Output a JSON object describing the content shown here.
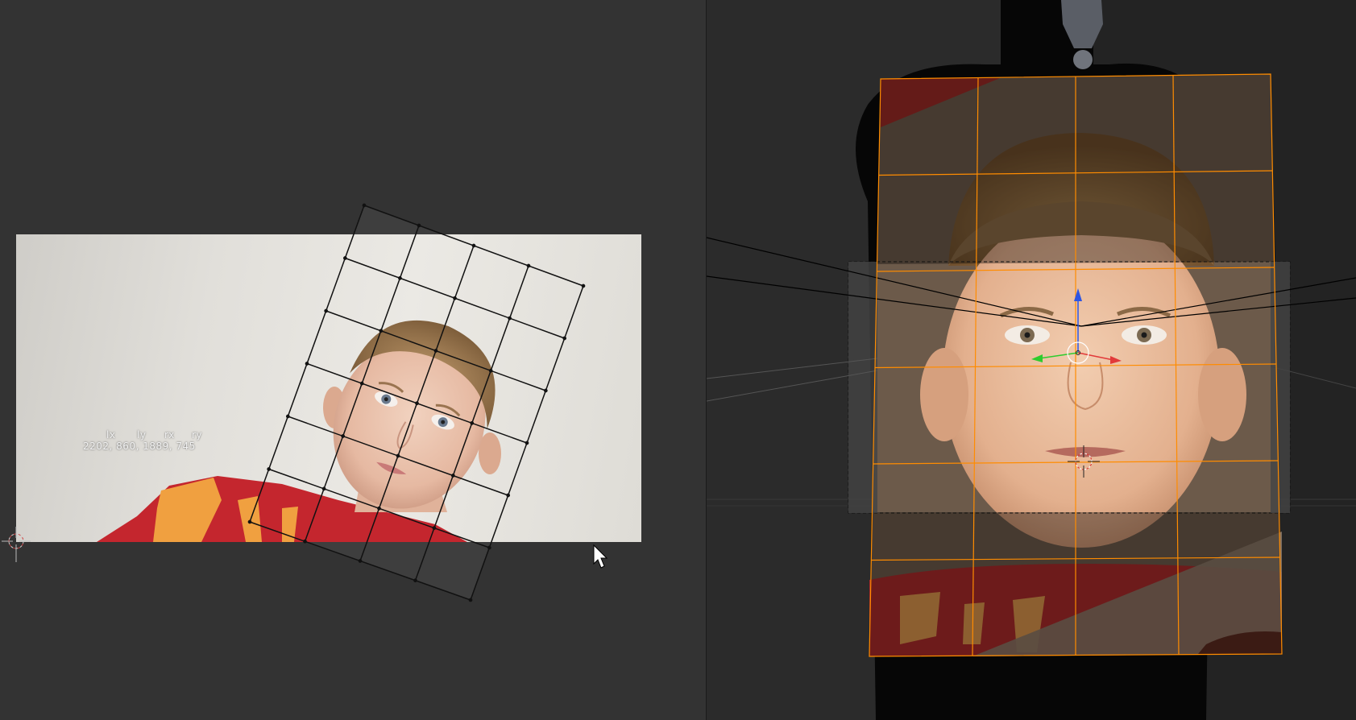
{
  "uv_editor": {
    "coord_labels": [
      "lx",
      "ly",
      "rx",
      "ry"
    ],
    "coord_values": "2202, 860, 1889, 745"
  },
  "colors": {
    "editor_bg": "#333333",
    "viewport_bg": "#2a2a2a",
    "uv_grid_line": "#111111",
    "mesh_edge_orange": "#ff8c00",
    "gizmo_x": "#e23a3a",
    "gizmo_y": "#2ecc2e",
    "gizmo_z": "#2e55e2",
    "shirt_red": "#c4262e",
    "shirt_orange": "#f0a040"
  },
  "icons": {
    "cursor": "mouse-pointer-icon",
    "uv_cursor": "2d-cursor-icon",
    "viewport_cursor": "3d-cursor-icon",
    "gizmo": "transform-gizmo-icon"
  }
}
